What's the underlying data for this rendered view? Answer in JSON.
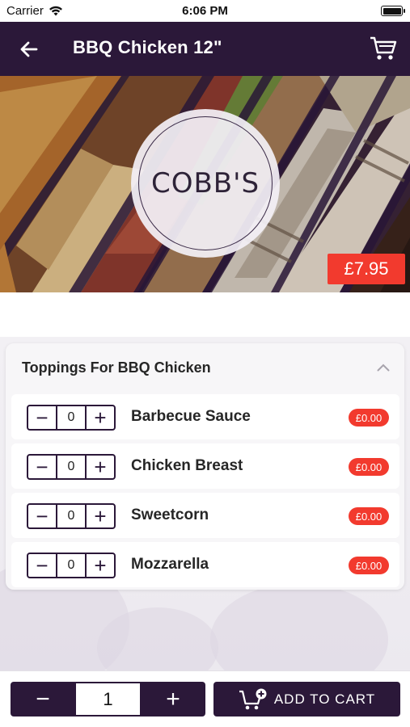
{
  "status_bar": {
    "carrier": "Carrier",
    "time": "6:06 PM"
  },
  "header": {
    "title": "BBQ Chicken 12\"",
    "back_icon": "back-arrow-icon",
    "cart_icon": "cart-icon"
  },
  "hero": {
    "logo_text": "COBB'S",
    "price": "£7.95"
  },
  "toppings": {
    "title": "Toppings For BBQ Chicken",
    "items": [
      {
        "name": "Barbecue Sauce",
        "qty": "0",
        "price": "£0.00"
      },
      {
        "name": "Chicken Breast",
        "qty": "0",
        "price": "£0.00"
      },
      {
        "name": "Sweetcorn",
        "qty": "0",
        "price": "£0.00"
      },
      {
        "name": "Mozzarella",
        "qty": "0",
        "price": "£0.00"
      }
    ]
  },
  "bottom": {
    "quantity": "1",
    "add_to_cart_label": "ADD TO CART"
  },
  "colors": {
    "brand": "#2b1839",
    "accent": "#f23a2e"
  }
}
